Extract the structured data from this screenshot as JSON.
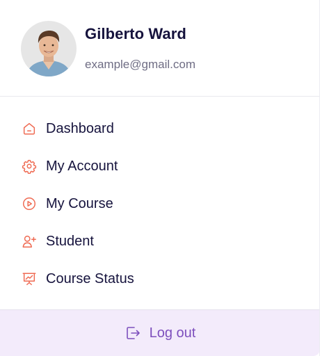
{
  "colors": {
    "accent": "#ef6a52",
    "text_primary": "#16133d",
    "text_secondary": "#6f6d84",
    "logout_bg": "#f3ebfb",
    "logout_text": "#7d4fbd"
  },
  "profile": {
    "name": "Gilberto Ward",
    "email": "example@gmail.com",
    "avatar_icon": "user-photo"
  },
  "menu": {
    "items": [
      {
        "label": "Dashboard",
        "icon": "home-icon"
      },
      {
        "label": "My Account",
        "icon": "gear-icon"
      },
      {
        "label": "My Course",
        "icon": "play-circle-icon"
      },
      {
        "label": "Student",
        "icon": "user-plus-icon"
      },
      {
        "label": "Course Status",
        "icon": "presentation-chart-icon"
      }
    ]
  },
  "logout": {
    "label": "Log out",
    "icon": "logout-icon"
  }
}
